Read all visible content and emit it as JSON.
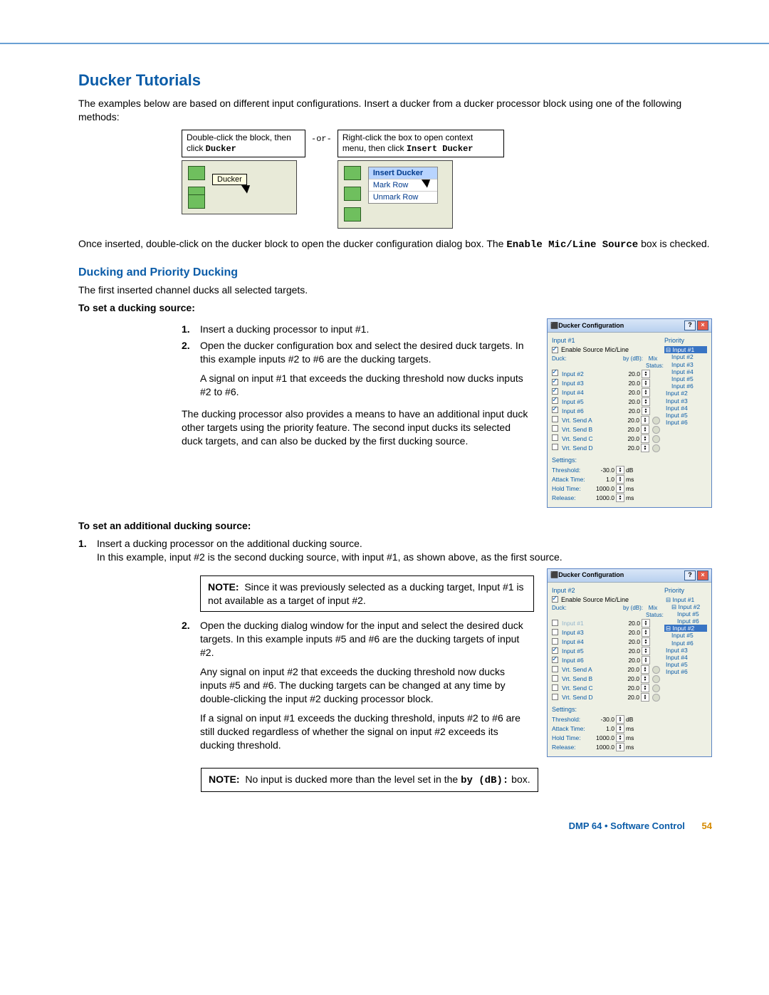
{
  "title": "Ducker Tutorials",
  "intro": "The examples below are based on different input configurations. Insert a ducker from a ducker processor block using one of the following methods:",
  "insert": {
    "cap1a": "Double-click the block, then click ",
    "cap1b": "Ducker",
    "or": "-or-",
    "cap2a": "Right-click the box to open context menu, then click ",
    "cap2b": "Insert Ducker",
    "tooltip": "Ducker",
    "menu": {
      "m1": "Insert Ducker",
      "m2": "Mark Row",
      "m3": "Unmark Row"
    }
  },
  "once_inserted_a": "Once inserted, double-click on the ducker block to open the ducker configuration dialog box. The ",
  "once_inserted_code": "Enable Mic/Line Source",
  "once_inserted_b": " box is checked.",
  "sub1": "Ducking and Priority Ducking",
  "sub1_p": "The first inserted channel ducks all selected targets.",
  "set_source_hdr": "To set a ducking source:",
  "steps1": {
    "s1": "Insert a ducking processor to input #1.",
    "s2": "Open the ducker configuration box and select the desired duck targets. In this example inputs #2 to #6 are the ducking targets.",
    "s2b": "A signal on input #1 that exceeds the ducking threshold now ducks inputs #2 to #6."
  },
  "sub1_p2": "The ducking processor also provides a means to have an additional input duck other targets using the priority feature. The second input ducks its selected duck targets, and can also be ducked by the first ducking source.",
  "set_addl_hdr": "To set an additional ducking source:",
  "steps2": {
    "s1": "Insert a ducking processor on the additional ducking source.",
    "s1b": "In this example, input #2 is the second ducking source, with input #1, as shown above, as the first source.",
    "s2": "Open the ducking dialog window for the input and select the desired duck targets. In this example inputs #5 and #6 are the ducking targets of input #2.",
    "s2b": "Any signal on input #2 that exceeds the ducking threshold now ducks inputs #5 and #6. The ducking targets can be changed at any time by double-clicking the input #2 ducking processor block.",
    "s2c": "If a signal on input #1 exceeds the ducking threshold, inputs #2 to #6 are still ducked regardless of whether the signal on input #2 exceeds its ducking threshold."
  },
  "note1_label": "NOTE:",
  "note1": "Since it was previously selected as a ducking target, Input #1 is not available as a target of input #2.",
  "note2_a": "No input is ducked more than the level set in the ",
  "note2_code": "by (dB):",
  "note2_b": " box.",
  "cfg_common": {
    "title": "Ducker Configuration",
    "enable": "Enable Source Mic/Line",
    "duck_hdr": "Duck:",
    "by_hdr": "by (dB):",
    "mix_hdr": "Mix Status:",
    "prio_hdr": "Priority",
    "settings_hdr": "Settings:",
    "thresh": "Threshold:",
    "attack": "Attack Time:",
    "hold": "Hold Time:",
    "release": "Release:",
    "unit_db": "dB",
    "unit_ms": "ms"
  },
  "cfg1": {
    "input_label": "Input #1",
    "rows": [
      {
        "name": "Input #2",
        "val": "20.0",
        "chk": true,
        "mix": false
      },
      {
        "name": "Input #3",
        "val": "20.0",
        "chk": true,
        "mix": false
      },
      {
        "name": "Input #4",
        "val": "20.0",
        "chk": true,
        "mix": false
      },
      {
        "name": "Input #5",
        "val": "20.0",
        "chk": true,
        "mix": false
      },
      {
        "name": "Input #6",
        "val": "20.0",
        "chk": true,
        "mix": false
      },
      {
        "name": "Vrt. Send A",
        "val": "20.0",
        "chk": false,
        "mix": true
      },
      {
        "name": "Vrt. Send B",
        "val": "20.0",
        "chk": false,
        "mix": true
      },
      {
        "name": "Vrt. Send C",
        "val": "20.0",
        "chk": false,
        "mix": true
      },
      {
        "name": "Vrt. Send D",
        "val": "20.0",
        "chk": false,
        "mix": true
      }
    ],
    "settings": {
      "thresh": "-30.0",
      "attack": "1.0",
      "hold": "1000.0",
      "release": "1000.0"
    },
    "prio": [
      {
        "t": "Input #1",
        "lv": 0,
        "sel": true,
        "tree": true
      },
      {
        "t": "Input #2",
        "lv": 1
      },
      {
        "t": "Input #3",
        "lv": 1
      },
      {
        "t": "Input #4",
        "lv": 1
      },
      {
        "t": "Input #5",
        "lv": 1
      },
      {
        "t": "Input #6",
        "lv": 1
      },
      {
        "t": "Input #2",
        "lv": 0
      },
      {
        "t": "Input #3",
        "lv": 0
      },
      {
        "t": "Input #4",
        "lv": 0
      },
      {
        "t": "Input #5",
        "lv": 0
      },
      {
        "t": "Input #6",
        "lv": 0
      }
    ]
  },
  "cfg2": {
    "input_label": "Input #2",
    "rows": [
      {
        "name": "Input #1",
        "val": "20.0",
        "chk": false,
        "mix": false,
        "disabled": true
      },
      {
        "name": "Input #3",
        "val": "20.0",
        "chk": false,
        "mix": false
      },
      {
        "name": "Input #4",
        "val": "20.0",
        "chk": false,
        "mix": false
      },
      {
        "name": "Input #5",
        "val": "20.0",
        "chk": true,
        "mix": false
      },
      {
        "name": "Input #6",
        "val": "20.0",
        "chk": true,
        "mix": false
      },
      {
        "name": "Vrt. Send A",
        "val": "20.0",
        "chk": false,
        "mix": true
      },
      {
        "name": "Vrt. Send B",
        "val": "20.0",
        "chk": false,
        "mix": true
      },
      {
        "name": "Vrt. Send C",
        "val": "20.0",
        "chk": false,
        "mix": true
      },
      {
        "name": "Vrt. Send D",
        "val": "20.0",
        "chk": false,
        "mix": true
      }
    ],
    "settings": {
      "thresh": "-30.0",
      "attack": "1.0",
      "hold": "1000.0",
      "release": "1000.0"
    },
    "prio": [
      {
        "t": "Input #1",
        "lv": 0,
        "tree": true
      },
      {
        "t": "Input #2",
        "lv": 1,
        "tree": true
      },
      {
        "t": "Input #5",
        "lv": 2
      },
      {
        "t": "Input #6",
        "lv": 2
      },
      {
        "t": "Input #2",
        "lv": 0,
        "sel": true,
        "tree": true
      },
      {
        "t": "Input #5",
        "lv": 1
      },
      {
        "t": "Input #6",
        "lv": 1
      },
      {
        "t": "Input #3",
        "lv": 0
      },
      {
        "t": "Input #4",
        "lv": 0
      },
      {
        "t": "Input #5",
        "lv": 0
      },
      {
        "t": "Input #6",
        "lv": 0
      }
    ]
  },
  "footer": {
    "label": "DMP 64 • Software Control",
    "page": "54"
  }
}
